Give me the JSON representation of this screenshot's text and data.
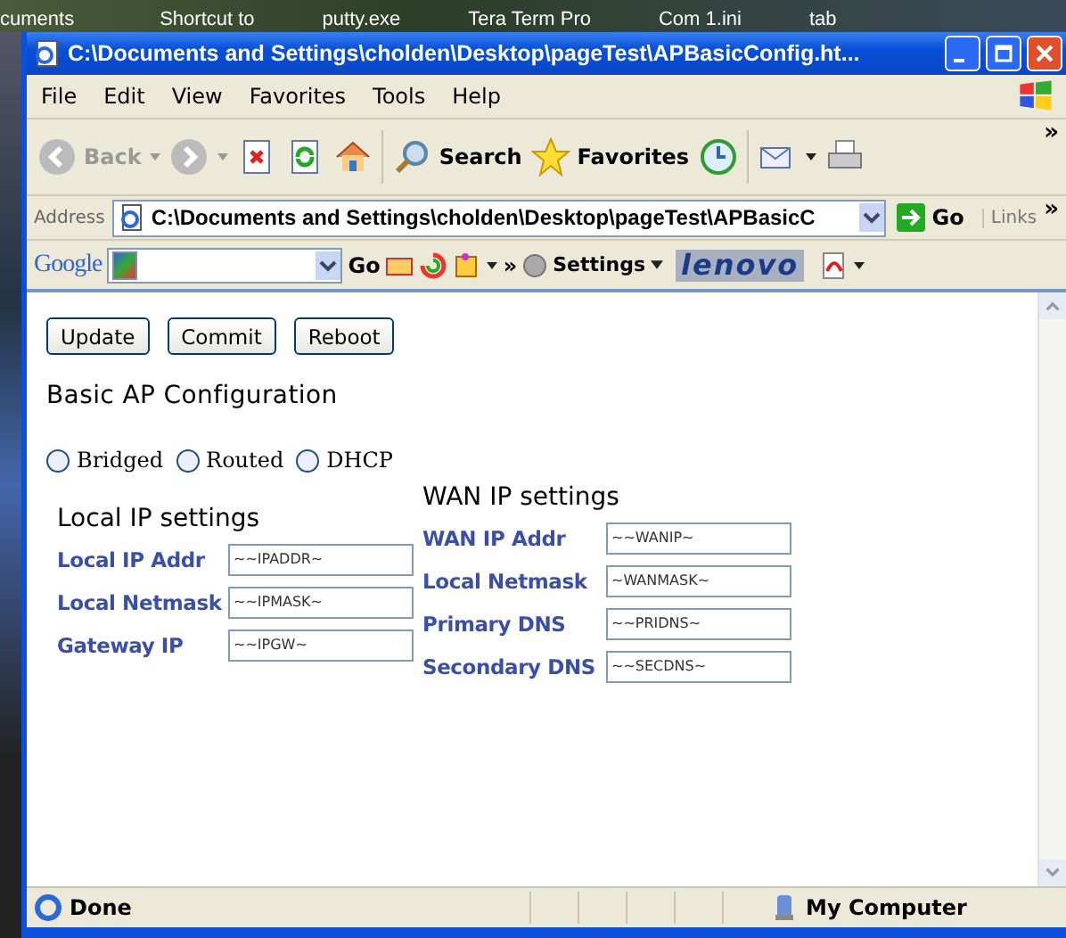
{
  "desktop": {
    "icon_labels": [
      "cuments",
      "Shortcut to",
      "putty.exe",
      "Tera Term Pro",
      "Com 1.ini",
      "tab"
    ]
  },
  "window": {
    "title": "C:\\Documents and Settings\\cholden\\Desktop\\pageTest\\APBasicConfig.ht..."
  },
  "menu": [
    "File",
    "Edit",
    "View",
    "Favorites",
    "Tools",
    "Help"
  ],
  "toolbar": {
    "back": "Back",
    "search": "Search",
    "favorites": "Favorites",
    "more": "»"
  },
  "address_bar": {
    "label": "Address",
    "value": "C:\\Documents and Settings\\cholden\\Desktop\\pageTest\\APBasicC",
    "go": "Go",
    "links": "Links",
    "more": "»"
  },
  "google_bar": {
    "logo": "Google",
    "go": "Go",
    "more": "»",
    "settings": "Settings",
    "brand": "lenovo"
  },
  "page": {
    "buttons": [
      "Update",
      "Commit",
      "Reboot"
    ],
    "heading": "Basic AP Configuration",
    "modes": [
      {
        "label": "Bridged",
        "selected": false
      },
      {
        "label": "Routed",
        "selected": false
      },
      {
        "label": "DHCP",
        "selected": false
      }
    ],
    "local": {
      "title": "Local IP settings",
      "fields": [
        {
          "label": "Local IP Addr",
          "value": "~~IPADDR~"
        },
        {
          "label": "Local Netmask",
          "value": "~~IPMASK~"
        },
        {
          "label": "Gateway IP",
          "value": "~~IPGW~"
        }
      ]
    },
    "wan": {
      "title": "WAN IP settings",
      "fields": [
        {
          "label": "WAN IP Addr",
          "value": "~~WANIP~"
        },
        {
          "label": "Local Netmask",
          "value": "~WANMASK~"
        },
        {
          "label": "Primary DNS",
          "value": "~~PRIDNS~"
        },
        {
          "label": "Secondary DNS",
          "value": "~~SECDNS~"
        }
      ]
    }
  },
  "status_bar": {
    "text": "Done",
    "zone": "My Computer"
  }
}
